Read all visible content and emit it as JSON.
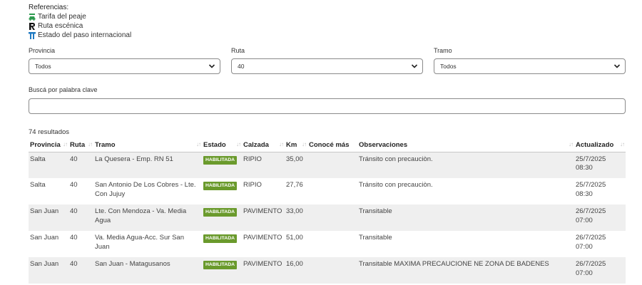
{
  "references": {
    "title": "Referencias:",
    "items": [
      {
        "label": "Tarifa del peaje",
        "icon": "toll-car-icon",
        "color": "#2e9b4f"
      },
      {
        "label": "Ruta escénica",
        "icon": "scenic-route-icon",
        "color": "#111111"
      },
      {
        "label": "Estado del paso internacional",
        "icon": "border-crossing-icon",
        "color": "#1f7ac2"
      }
    ]
  },
  "filters": {
    "provincia": {
      "label": "Provincia",
      "value": "Todos"
    },
    "ruta": {
      "label": "Ruta",
      "value": "40"
    },
    "tramo": {
      "label": "Tramo",
      "value": "Todos"
    }
  },
  "search": {
    "label": "Buscá por palabra clave",
    "value": ""
  },
  "results_count": "74 resultados",
  "table": {
    "columns": [
      "Provincia",
      "Ruta",
      "Tramo",
      "Estado",
      "Calzada",
      "Km",
      "Conocé más",
      "Observaciones",
      "Actualizado"
    ],
    "rows": [
      {
        "provincia": "Salta",
        "ruta": "40",
        "tramo": "La Quesera - Emp. RN 51",
        "estado": "HABILITADA",
        "calzada": "RIPIO",
        "km": "35,00",
        "conoce": "",
        "observaciones": "Tránsito con precauciòn.",
        "actualizado": "25/7/2025 08:30"
      },
      {
        "provincia": "Salta",
        "ruta": "40",
        "tramo": "San Antonio De Los Cobres - Lte. Con Jujuy",
        "estado": "HABILITADA",
        "calzada": "RIPIO",
        "km": "27,76",
        "conoce": "",
        "observaciones": "Tránsito con precauciòn.",
        "actualizado": "25/7/2025 08:30"
      },
      {
        "provincia": "San Juan",
        "ruta": "40",
        "tramo": "Lte. Con Mendoza - Va. Media Agua",
        "estado": "HABILITADA",
        "calzada": "PAVIMENTO",
        "km": "33,00",
        "conoce": "",
        "observaciones": "Transitable",
        "actualizado": "26/7/2025 07:00"
      },
      {
        "provincia": "San Juan",
        "ruta": "40",
        "tramo": "Va. Media Agua-Acc. Sur San Juan",
        "estado": "HABILITADA",
        "calzada": "PAVIMENTO",
        "km": "51,00",
        "conoce": "",
        "observaciones": "Transitable",
        "actualizado": "26/7/2025 07:00"
      },
      {
        "provincia": "San Juan",
        "ruta": "40",
        "tramo": "San Juan - Matagusanos",
        "estado": "HABILITADA",
        "calzada": "PAVIMENTO",
        "km": "16,00",
        "conoce": "",
        "observaciones": "Transitable MAXIMA PRECAUCIONE NE ZONA DE BADENES",
        "actualizado": "26/7/2025 07:00"
      }
    ]
  },
  "colors": {
    "badge": "#6a9a2c",
    "row_stripe": "#efefef"
  }
}
